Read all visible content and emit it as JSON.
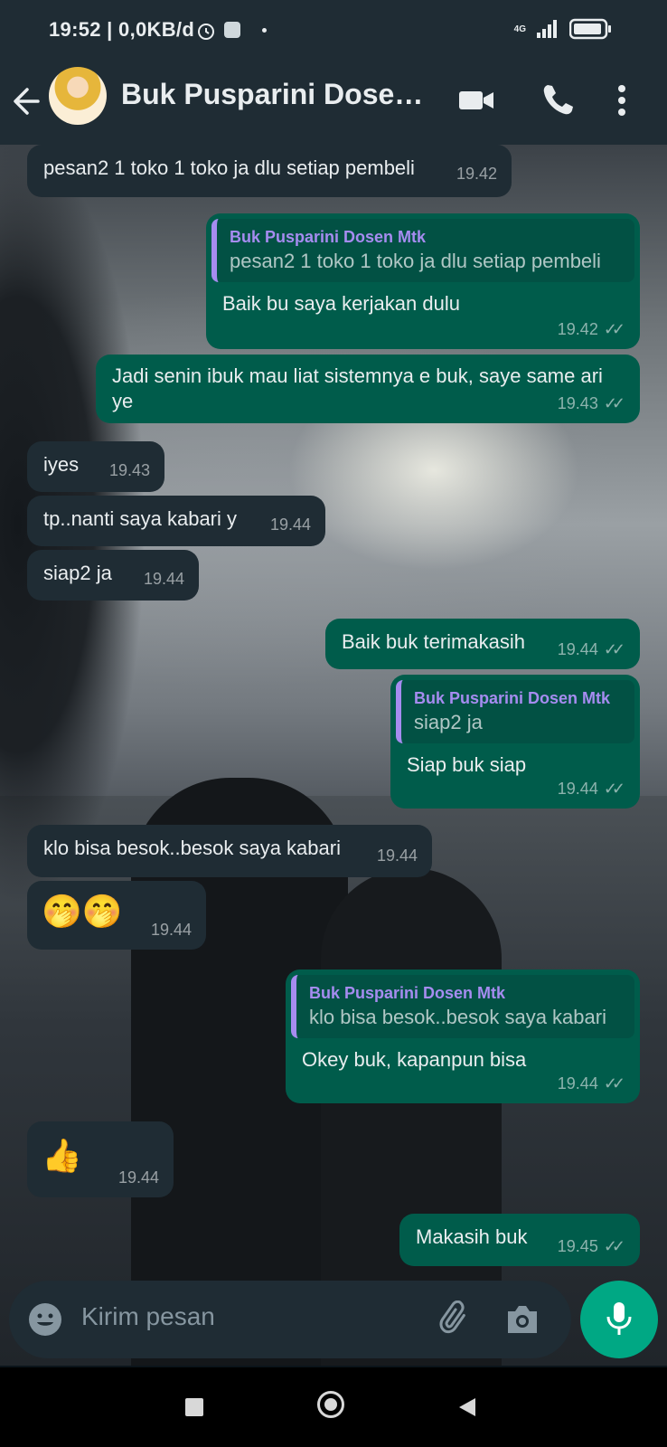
{
  "status": {
    "time": "19:52 | 0,0KB/d",
    "network": "4G"
  },
  "header": {
    "title": "Buk Pusparini Dosen…"
  },
  "messages": [
    {
      "dir": "in",
      "text": "pesan2 1 toko 1 toko ja dlu setiap pembeli",
      "time": "19.42"
    },
    {
      "dir": "out",
      "quote": {
        "name": "Buk Pusparini Dosen Mtk",
        "text": "pesan2 1 toko 1 toko ja dlu setiap pembeli"
      },
      "text": "Baik bu saya kerjakan dulu",
      "time": "19.42"
    },
    {
      "dir": "out",
      "text": "Jadi senin ibuk mau liat sistemnya e buk, saye same ari ye",
      "time": "19.43"
    },
    {
      "dir": "in",
      "text": "iyes",
      "time": "19.43"
    },
    {
      "dir": "in",
      "text": "tp..nanti saya kabari y",
      "time": "19.44"
    },
    {
      "dir": "in",
      "text": "siap2 ja",
      "time": "19.44"
    },
    {
      "dir": "out",
      "text": "Baik buk terimakasih",
      "time": "19.44"
    },
    {
      "dir": "out",
      "quote": {
        "name": "Buk Pusparini Dosen Mtk",
        "text": "siap2 ja"
      },
      "text": "Siap buk siap",
      "time": "19.44"
    },
    {
      "dir": "in",
      "text": "klo bisa besok..besok saya kabari",
      "time": "19.44"
    },
    {
      "dir": "in",
      "text": "🤭🤭",
      "time": "19.44"
    },
    {
      "dir": "out",
      "quote": {
        "name": "Buk Pusparini Dosen Mtk",
        "text": "klo bisa besok..besok saya kabari"
      },
      "text": "Okey buk, kapanpun bisa",
      "time": "19.44"
    },
    {
      "dir": "in",
      "text": "👍",
      "time": "19.44"
    },
    {
      "dir": "out",
      "text": "Makasih buk",
      "time": "19.45"
    }
  ],
  "composer": {
    "placeholder": "Kirim pesan"
  },
  "icons": {
    "back": "arrow-left-icon",
    "video": "video-call-icon",
    "call": "phone-icon",
    "menu": "more-vert-icon",
    "emoji": "emoji-icon",
    "attach": "paperclip-icon",
    "camera": "camera-icon",
    "mic": "mic-icon",
    "nav_recents": "square-icon",
    "nav_home": "circle-icon",
    "nav_back": "triangle-back-icon"
  },
  "colors": {
    "incoming_bubble": "#1f2c34",
    "outgoing_bubble": "#005c4b",
    "quote_accent": "#a68cf0",
    "mic_button": "#00a884"
  }
}
